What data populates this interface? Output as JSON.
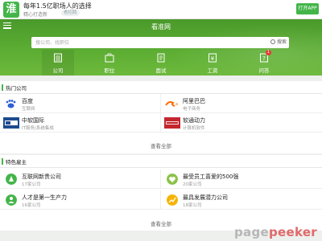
{
  "banner": {
    "logo_char": "淮",
    "title": "每年1.5亿职场人的选择",
    "subtitle": "精心打造新",
    "tag": "看招聘",
    "open_button": "打开APP"
  },
  "header": {
    "title": "看准网",
    "search_placeholder": "搜公司、找职位",
    "search_button": "搜索"
  },
  "nav": {
    "items": [
      {
        "label": "公司",
        "icon": "building-icon",
        "active": true
      },
      {
        "label": "职位",
        "icon": "briefcase-icon",
        "active": false
      },
      {
        "label": "面试",
        "icon": "document-icon",
        "active": false
      },
      {
        "label": "工资",
        "icon": "yen-icon",
        "active": false
      },
      {
        "label": "问答",
        "icon": "qa-icon",
        "active": false,
        "badge": "1"
      }
    ]
  },
  "hot_companies": {
    "title": "热门公司",
    "items": [
      {
        "name": "百度",
        "desc": "互联网",
        "logo": "baidu-logo-icon"
      },
      {
        "name": "阿里巴巴",
        "desc": "电子商务",
        "logo": "alibaba-logo-icon"
      },
      {
        "name": "中软国际",
        "desc": "IT服务|系统集成",
        "logo": "chinasoft-logo-icon"
      },
      {
        "name": "软通动力",
        "desc": "计算机软件",
        "logo": "isoftstone-logo-icon"
      }
    ],
    "more": "查看全部"
  },
  "featured": {
    "title": "特色雇主",
    "items": [
      {
        "name": "互联网新贵公司",
        "desc": "17家公司",
        "icon": "rocket-icon",
        "color": "#43b549"
      },
      {
        "name": "最受员工喜爱的500强",
        "desc": "20家公司",
        "icon": "heart-icon",
        "color": "#8bc34a"
      },
      {
        "name": "人才是第一生产力",
        "desc": "16家公司",
        "icon": "person-icon",
        "color": "#43b549"
      },
      {
        "name": "最具发展潜力公司",
        "desc": "18家公司",
        "icon": "growth-icon",
        "color": "#f5b400"
      }
    ],
    "more": "查看全部"
  },
  "watermark": {
    "part1": "page",
    "part2": "peeker"
  },
  "colors": {
    "brand": "#43b549",
    "header": "#5cad33"
  }
}
